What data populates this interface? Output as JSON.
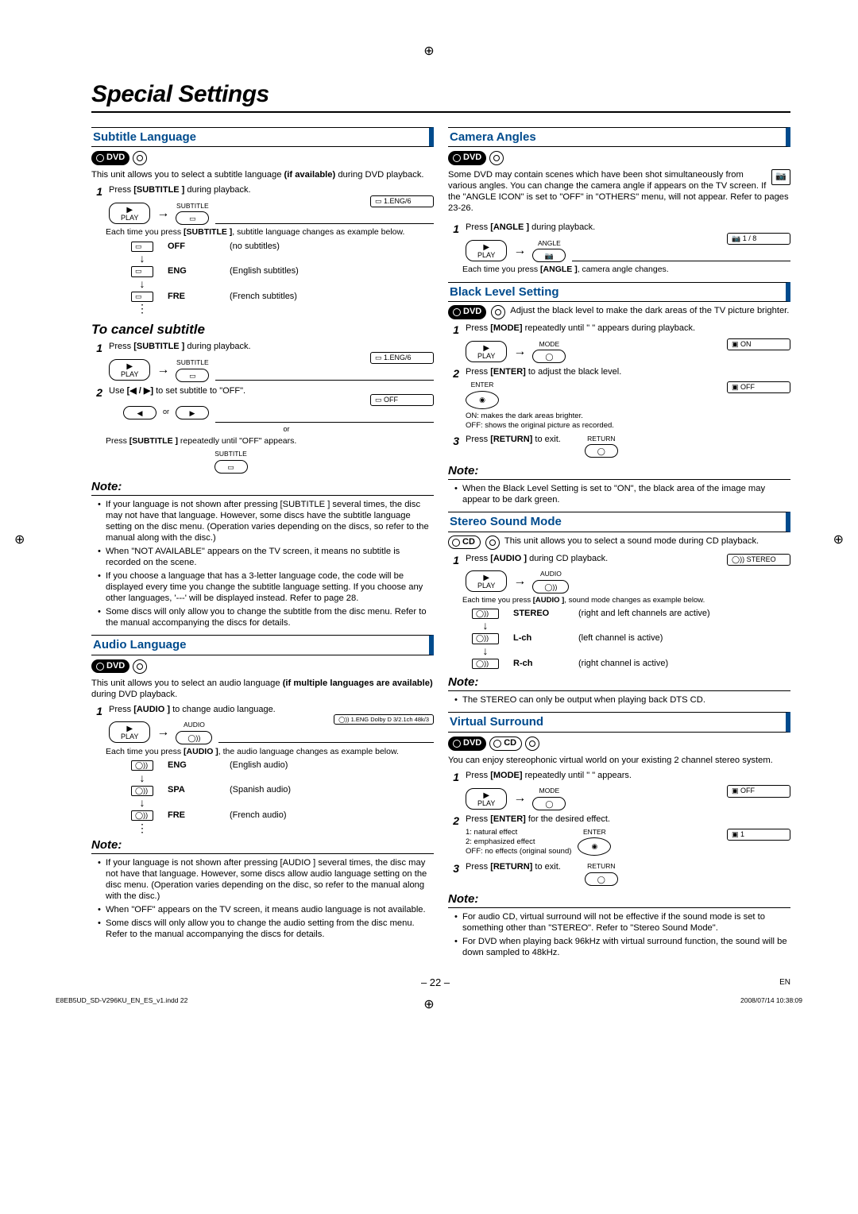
{
  "page": {
    "title": "Special Settings",
    "number": "– 22 –",
    "lang": "EN",
    "indd": "E8EB5UD_SD-V296KU_EN_ES_v1.indd   22",
    "timestamp": "2008/07/14   10:38:09"
  },
  "badges": {
    "dvd": "DVD",
    "cd": "CD"
  },
  "subtitle": {
    "heading": "Subtitle Language",
    "intro_a": "This unit allows you to select a subtitle language ",
    "intro_b": "(if available)",
    "intro_c": " during DVD playback.",
    "step1_a": "Press ",
    "step1_b": "[SUBTITLE ]",
    "step1_c": " during playback.",
    "btn_play": "PLAY",
    "btn_sub": "SUBTITLE",
    "callout1": "1.ENG/6",
    "caption1_a": "Each time you press ",
    "caption1_b": "[SUBTITLE ]",
    "caption1_c": ", subtitle language changes as example below.",
    "row_off": "OFF",
    "row_off_desc": "(no subtitles)",
    "row_eng": "ENG",
    "row_eng_desc": "(English subtitles)",
    "row_fre": "FRE",
    "row_fre_desc": "(French subtitles)",
    "cancel_head": "To cancel subtitle",
    "cancel1_a": "Press ",
    "cancel1_b": "[SUBTITLE ]",
    "cancel1_c": " during playback.",
    "cancel2_a": "Use ",
    "cancel2_b": "[◀ / ▶]",
    "cancel2_c": " to set subtitle to \"OFF\".",
    "or": "or",
    "off_box": "OFF",
    "cancel_cap_a": "Press ",
    "cancel_cap_b": "[SUBTITLE ]",
    "cancel_cap_c": " repeatedly until \"OFF\" appears.",
    "note_head": "Note:",
    "note1": "If your language is not shown after pressing [SUBTITLE ] several times, the disc may not have that language. However, some discs have the subtitle language setting on the disc menu. (Operation varies depending on the discs, so refer to the manual along with the disc.)",
    "note2": "When \"NOT AVAILABLE\" appears on the TV screen, it means no subtitle is recorded on the scene.",
    "note3": "If you choose a language that has a 3-letter language code, the code will be displayed every time you change the subtitle language setting. If you choose any other languages, '---' will be displayed instead. Refer to page 28.",
    "note4": "Some discs will only allow you to change the subtitle from the disc menu. Refer to the manual accompanying the discs for details."
  },
  "audio": {
    "heading": "Audio Language",
    "intro_a": "This unit allows you to select an audio language ",
    "intro_b": "(if multiple languages are available)",
    "intro_c": " during DVD playback.",
    "step1_a": "Press ",
    "step1_b": "[AUDIO ]",
    "step1_c": " to change audio language.",
    "btn_audio": "AUDIO",
    "callout1": "1.ENG  Dolby D  3/2.1ch  48k/3",
    "caption1_a": "Each time you press ",
    "caption1_b": "[AUDIO ]",
    "caption1_c": ", the audio language changes as example below.",
    "row_eng": "ENG",
    "row_eng_desc": "(English audio)",
    "row_spa": "SPA",
    "row_spa_desc": "(Spanish audio)",
    "row_fre": "FRE",
    "row_fre_desc": "(French audio)",
    "note_head": "Note:",
    "note1": "If your language is not shown after pressing [AUDIO ] several times, the disc may not have that language. However, some discs allow audio language setting on the disc menu. (Operation varies depending on the disc, so refer to the manual along with the disc.)",
    "note2": "When \"OFF\" appears on the TV screen, it means audio language is not available.",
    "note3": "Some discs will only allow you to change the audio setting from the disc menu. Refer to the manual accompanying the discs for details."
  },
  "camera": {
    "heading": "Camera Angles",
    "intro": "Some DVD may contain scenes which have been shot simultaneously from various angles. You can change the camera angle if  appears on the TV screen. If the \"ANGLE ICON\" is set to \"OFF\" in \"OTHERS\" menu,  will not appear. Refer to pages 23-26.",
    "step1_a": "Press ",
    "step1_b": "[ANGLE ]",
    "step1_c": " during playback.",
    "btn_angle": "ANGLE",
    "callout1": "1 / 8",
    "caption1_a": "Each time you press ",
    "caption1_b": "[ANGLE ]",
    "caption1_c": ", camera angle changes."
  },
  "black": {
    "heading": "Black Level Setting",
    "intro": "Adjust the black level to make the dark areas of the TV picture brighter.",
    "step1_a": "Press ",
    "step1_b": "[MODE]",
    "step1_c": " repeatedly until \"  \" appears during playback.",
    "btn_mode": "MODE",
    "on_box": "ON",
    "step2_a": "Press ",
    "step2_b": "[ENTER]",
    "step2_c": " to adjust the black level.",
    "btn_enter": "ENTER",
    "off_box": "OFF",
    "on_desc": "ON: makes the dark areas brighter.",
    "off_desc": "OFF: shows the original picture as recorded.",
    "step3_a": "Press ",
    "step3_b": "[RETURN]",
    "step3_c": " to exit.",
    "btn_return": "RETURN",
    "note_head": "Note:",
    "note1": "When the Black Level Setting is set to \"ON\", the black area of the image may appear to be dark green."
  },
  "stereo": {
    "heading": "Stereo Sound Mode",
    "intro": "This unit allows you to select a sound mode during CD playback.",
    "step1_a": "Press ",
    "step1_b": "[AUDIO ]",
    "step1_c": " during CD playback.",
    "callout1": "STEREO",
    "caption1_a": "Each time you press ",
    "caption1_b": "[AUDIO ]",
    "caption1_c": ", sound mode changes as example below.",
    "row_stereo": "STEREO",
    "row_stereo_desc": "(right and left channels are active)",
    "row_l": "L-ch",
    "row_l_desc": "(left channel is active)",
    "row_r": "R-ch",
    "row_r_desc": "(right channel is active)",
    "note_head": "Note:",
    "note1": "The STEREO can only be output when playing back DTS CD."
  },
  "virtual": {
    "heading": "Virtual Surround",
    "intro": "You can enjoy stereophonic virtual world on your existing 2 channel stereo system.",
    "step1_a": "Press ",
    "step1_b": "[MODE]",
    "step1_c": " repeatedly until \"  \" appears.",
    "off_box": "OFF",
    "step2_a": "Press ",
    "step2_b": "[ENTER]",
    "step2_c": " for the desired effect.",
    "eff1": "1: natural effect",
    "eff2": "2: emphasized effect",
    "eff_off": "OFF: no effects (original sound)",
    "one_box": "1",
    "step3_a": "Press ",
    "step3_b": "[RETURN]",
    "step3_c": " to exit.",
    "note_head": "Note:",
    "note1": "For audio CD, virtual surround will not be effective if the sound mode is set to something other than \"STEREO\". Refer to \"Stereo Sound Mode\".",
    "note2": "For DVD when playing back 96kHz with virtual surround function, the sound will be down sampled to 48kHz."
  }
}
